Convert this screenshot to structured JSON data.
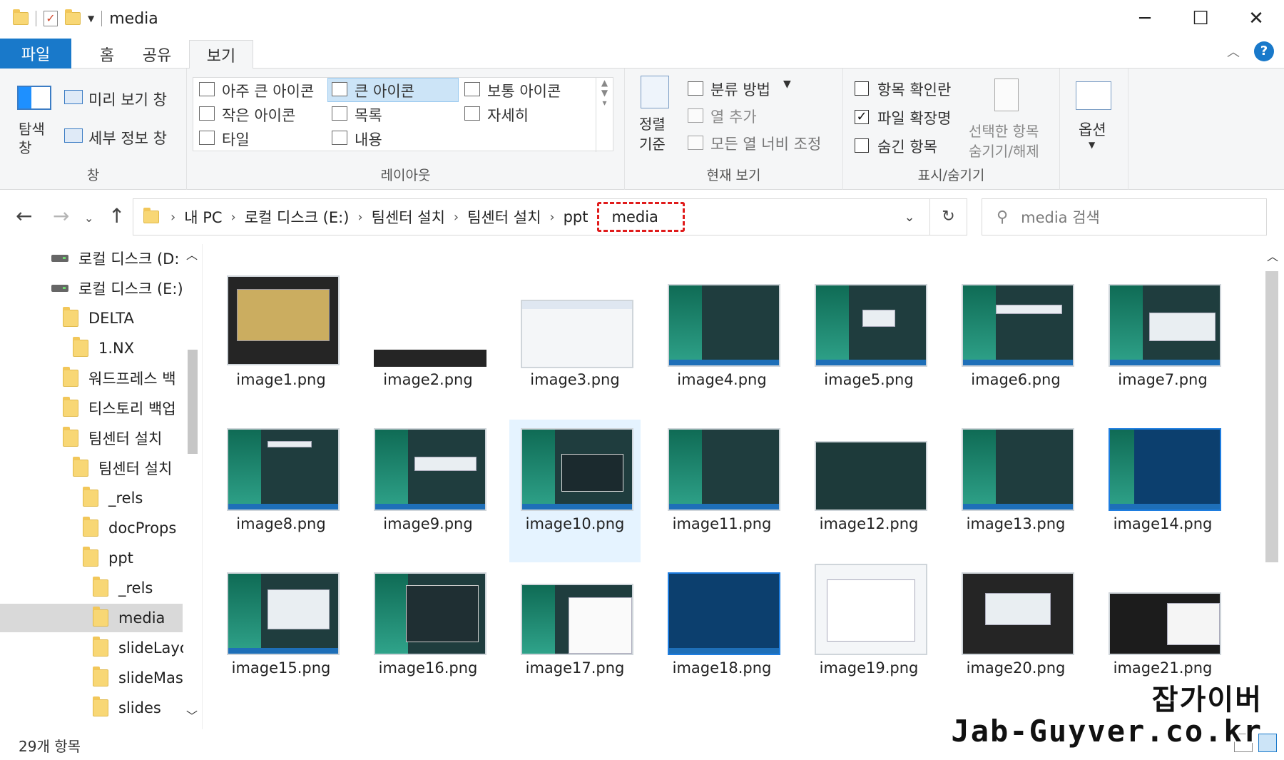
{
  "window": {
    "title": "media",
    "controls": {
      "minimize": "─",
      "maximize": "☐",
      "close": "✕"
    }
  },
  "tabs": {
    "file": "파일",
    "home": "홈",
    "share": "공유",
    "view": "보기",
    "help": "?"
  },
  "ribbon": {
    "pane": {
      "nav_pane": "탐색\n창",
      "preview_pane": "미리 보기 창",
      "details_pane": "세부 정보 창",
      "label": "창"
    },
    "layout": {
      "extra_large": "아주 큰 아이콘",
      "large": "큰 아이콘",
      "medium": "보통 아이콘",
      "small": "작은 아이콘",
      "list": "목록",
      "details": "자세히",
      "tiles": "타일",
      "content": "내용",
      "label": "레이아웃"
    },
    "current_view": {
      "sort": "정렬\n기준",
      "group_by": "분류 방법",
      "add_columns": "열 추가",
      "size_columns": "모든 열 너비 조정",
      "label": "현재 보기"
    },
    "show_hide": {
      "item_checkboxes": "항목 확인란",
      "file_extensions": "파일 확장명",
      "hidden_items": "숨긴 항목",
      "hide_selected_1": "선택한 항목",
      "hide_selected_2": "숨기기/해제",
      "label": "표시/숨기기",
      "item_checkboxes_checked": false,
      "file_extensions_checked": true,
      "hidden_items_checked": false
    },
    "options": "옵션"
  },
  "address": {
    "crumbs": [
      "내 PC",
      "로컬 디스크 (E:)",
      "팀센터 설치",
      "팀센터 설치",
      "ppt"
    ],
    "current": "media",
    "search_placeholder": "media 검색"
  },
  "sidebar": {
    "items": [
      {
        "label": "로컬 디스크 (D:",
        "type": "drive"
      },
      {
        "label": "로컬 디스크 (E:)",
        "type": "drive"
      },
      {
        "label": "DELTA",
        "type": "folder"
      },
      {
        "label": "1.NX",
        "type": "folder"
      },
      {
        "label": "워드프레스 백",
        "type": "folder"
      },
      {
        "label": "티스토리 백업",
        "type": "folder"
      },
      {
        "label": "팀센터 설치",
        "type": "folder"
      },
      {
        "label": "팀센터 설치",
        "type": "folder"
      },
      {
        "label": "_rels",
        "type": "folder"
      },
      {
        "label": "docProps",
        "type": "folder"
      },
      {
        "label": "ppt",
        "type": "folder"
      },
      {
        "label": "_rels",
        "type": "folder"
      },
      {
        "label": "media",
        "type": "folder",
        "selected": true
      },
      {
        "label": "slideLayou",
        "type": "folder"
      },
      {
        "label": "slideMaste",
        "type": "folder"
      },
      {
        "label": "slides",
        "type": "folder"
      }
    ]
  },
  "files": [
    "image1.png",
    "image2.png",
    "image3.png",
    "image4.png",
    "image5.png",
    "image6.png",
    "image7.png",
    "image8.png",
    "image9.png",
    "image10.png",
    "image11.png",
    "image12.png",
    "image13.png",
    "image14.png",
    "image15.png",
    "image16.png",
    "image17.png",
    "image18.png",
    "image19.png",
    "image20.png",
    "image21.png"
  ],
  "selected_file": "image10.png",
  "status": {
    "count": "29개 항목"
  },
  "watermark": {
    "name": "잡가이버",
    "url": "Jab-Guyver.co.kr"
  },
  "colors": {
    "accent": "#1979ca",
    "highlight": "#e01b1b",
    "selection": "#e5f3ff"
  }
}
